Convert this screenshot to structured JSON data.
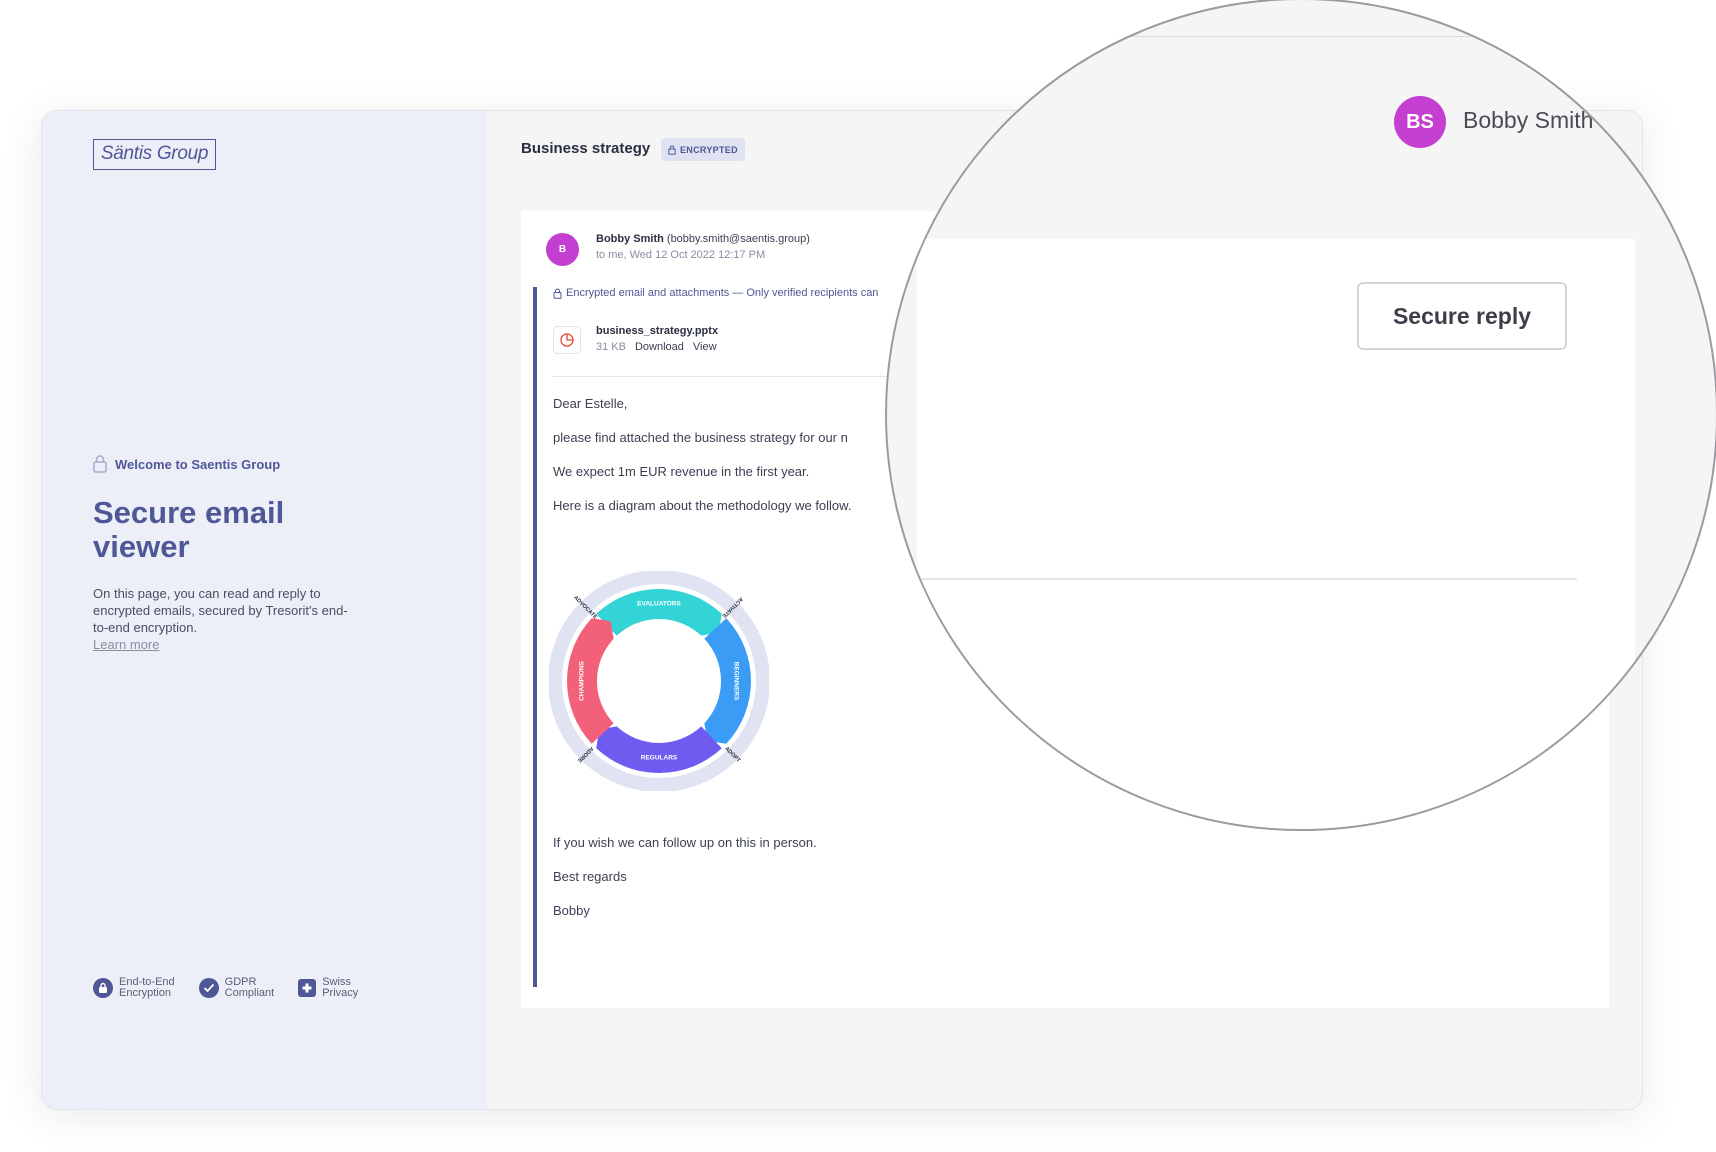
{
  "sidebar": {
    "logo": "Säntis Group",
    "welcome": "Welcome to Saentis Group",
    "title": "Secure email viewer",
    "description": "On this page, you can read and reply to encrypted emails, secured by Tresorit's end-to-end encryption.",
    "learn_more": "Learn more",
    "badges": [
      {
        "icon": "lock-icon",
        "label": "End-to-End\nEncryption"
      },
      {
        "icon": "check-icon",
        "label": "GDPR\nCompliant"
      },
      {
        "icon": "swiss-cross-icon",
        "label": "Swiss\nPrivacy"
      }
    ]
  },
  "email": {
    "subject": "Business strategy",
    "encrypted_badge": "ENCRYPTED",
    "sender_initial": "B",
    "sender_name": "Bobby Smith",
    "sender_email": "(bobby.smith@saentis.group)",
    "sender_meta": "to me, Wed 12 Oct 2022 12:17 PM",
    "encryption_notice": "Encrypted email and attachments — Only verified recipients can",
    "attachment": {
      "name": "business_strategy.pptx",
      "size": "31 KB",
      "download": "Download",
      "view": "View"
    },
    "body": {
      "greeting": "Dear Estelle,",
      "line1": "please find attached the business strategy for our n",
      "line2": "We expect 1m EUR revenue in the first year.",
      "line3": "Here is a diagram about the methodology we follow.",
      "line4": "If you wish we can follow up on this in person.",
      "closing": "Best regards",
      "signature": "Bobby"
    },
    "diagram": {
      "segments": [
        {
          "label": "EVALUATORS",
          "color": "#33d4d6"
        },
        {
          "label": "BEGINNERS",
          "color": "#3a9cf5"
        },
        {
          "label": "REGULARS",
          "color": "#6e5cf0"
        },
        {
          "label": "CHAMPIONS",
          "color": "#f2607a"
        }
      ],
      "transitions": [
        "ACTIVATE",
        "ADOPT",
        "ADORE",
        "ADVOCATE"
      ]
    }
  },
  "magnifier": {
    "avatar_initials": "BS",
    "user_name": "Bobby Smith",
    "reply_button": "Secure reply"
  },
  "colors": {
    "accent": "#4f5796",
    "avatar": "#c43ed1",
    "sidebar_bg": "#edeff8"
  }
}
